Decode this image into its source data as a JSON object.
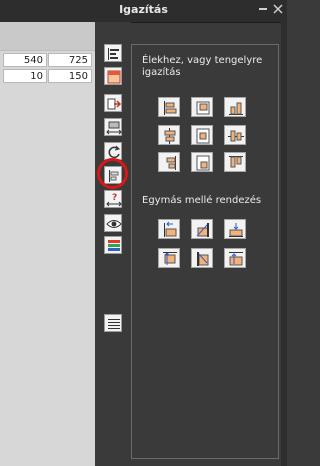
{
  "window": {
    "title": "Igazítás",
    "pin_icon": "pin-icon",
    "close_icon": "close-icon"
  },
  "spreadsheet": {
    "rows": [
      [
        "540",
        "725"
      ],
      [
        "10",
        "150"
      ]
    ]
  },
  "toolbar": {
    "items": [
      "align-left-bars-icon",
      "align-top-block-icon",
      "move-right-icon",
      "stretch-horizontal-icon",
      "rotate-icon",
      "align-objects-icon",
      "question-distance-icon",
      "view-eye-icon",
      "color-bars-icon",
      "list-icon"
    ],
    "highlighted": "align-objects-icon",
    "highlight_color": "#d81818"
  },
  "panel": {
    "section1_title": "Élekhez, vagy tengelyre igazítás",
    "section2_title": "Egymás mellé rendezés",
    "accent": "#f2b27a"
  }
}
